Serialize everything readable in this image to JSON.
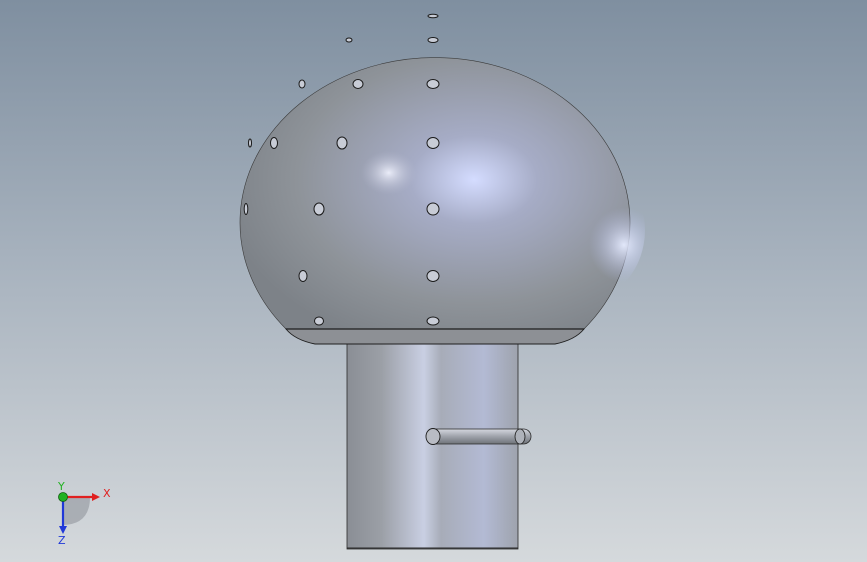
{
  "viewport": {
    "background_top": "#7f8fa0",
    "background_bottom": "#d5d9dc"
  },
  "model": {
    "sphere_color": "#8d9298",
    "sphere_highlight": "#c9d3ff",
    "cylinder_color": "#9a9ea6",
    "cylinder_highlight": "#dde3f5",
    "edge_color": "#1e1e1e"
  },
  "triad": {
    "x_label": "X",
    "y_label": "Y",
    "z_label": "Z",
    "x_color": "#e02020",
    "y_color": "#22b222",
    "z_color": "#2038d8"
  }
}
